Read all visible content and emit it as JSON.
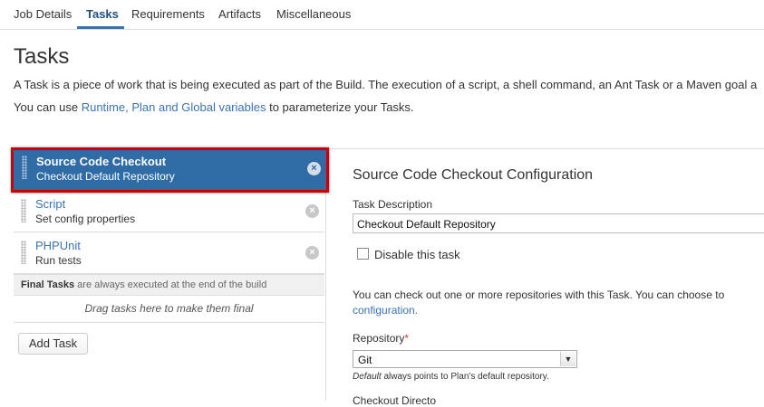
{
  "tabs": [
    {
      "label": "Job Details"
    },
    {
      "label": "Tasks"
    },
    {
      "label": "Requirements"
    },
    {
      "label": "Artifacts"
    },
    {
      "label": "Miscellaneous"
    }
  ],
  "page": {
    "title": "Tasks",
    "intro_line1": "A Task is a piece of work that is being executed as part of the Build. The execution of a script, a shell command, an Ant Task or a Maven goal a",
    "intro_line2_prefix": "You can use ",
    "intro_link": "Runtime, Plan and Global variables",
    "intro_line2_suffix": " to parameterize your Tasks."
  },
  "tasks": [
    {
      "name": "Source Code Checkout",
      "description": "Checkout Default Repository"
    },
    {
      "name": "Script",
      "description": "Set config properties"
    },
    {
      "name": "PHPUnit",
      "description": "Run tests"
    }
  ],
  "final_tasks": {
    "bold": "Final Tasks",
    "text": " are always executed at the end of the build"
  },
  "drag_hint": "Drag tasks here to make them final",
  "add_task_label": "Add Task",
  "config": {
    "title": "Source Code Checkout Configuration",
    "task_description_label": "Task Description",
    "task_description_value": "Checkout Default Repository",
    "disable_label": "Disable this task",
    "info_line1": "You can check out one or more repositories with this Task. You can choose to",
    "info_link": "configuration.",
    "repository_label": "Repository",
    "repository_required": "*",
    "repository_value": "Git",
    "hint_italic": "Default",
    "hint_rest": " always points to Plan's default repository.",
    "next_label": "Checkout Directo"
  },
  "colors": {
    "accent": "#3b73af",
    "selected_bg": "#2f6ba5",
    "highlight_border": "#cc0000"
  },
  "icons": {
    "delete": "close-circle-icon",
    "grip": "drag-handle-icon",
    "select_arrow": "chevron-down-icon"
  }
}
